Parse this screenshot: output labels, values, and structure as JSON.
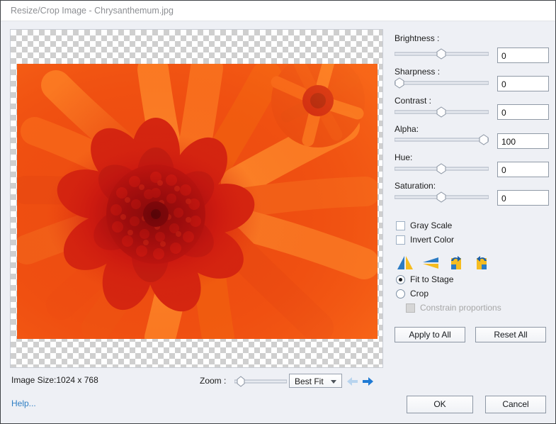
{
  "window": {
    "title": "Resize/Crop Image - Chrysanthemum.jpg"
  },
  "canvas": {
    "image_name": "Chrysanthemum.jpg",
    "image_alt": "Close-up photograph of an orange chrysanthemum flower with a deep red center",
    "transparency_checkerboard": true
  },
  "adjustments": [
    {
      "label": "Brightness :",
      "value": "0",
      "slider_pct": 50
    },
    {
      "label": "Sharpness :",
      "value": "0",
      "slider_pct": 0
    },
    {
      "label": "Contrast :",
      "value": "0",
      "slider_pct": 50
    },
    {
      "label": "Alpha:",
      "value": "100",
      "slider_pct": 100
    },
    {
      "label": "Hue:",
      "value": "0",
      "slider_pct": 50
    },
    {
      "label": "Saturation:",
      "value": "0",
      "slider_pct": 50
    }
  ],
  "checkboxes": [
    {
      "label": "Gray Scale",
      "checked": false,
      "enabled": true
    },
    {
      "label": "Invert Color",
      "checked": false,
      "enabled": true
    }
  ],
  "transform_icons": [
    {
      "name": "flip-vertical-icon",
      "tooltip": "Flip Vertical"
    },
    {
      "name": "flip-horizontal-icon",
      "tooltip": "Flip Horizontal"
    },
    {
      "name": "rotate-left-icon",
      "tooltip": "Rotate Left"
    },
    {
      "name": "rotate-right-icon",
      "tooltip": "Rotate Right"
    }
  ],
  "mode_radios": [
    {
      "label": "Fit to Stage",
      "selected": true
    },
    {
      "label": "Crop",
      "selected": false
    }
  ],
  "constrain": {
    "label": "Constrain proportions",
    "checked": false,
    "enabled": false
  },
  "panel_buttons": {
    "apply_to_all": "Apply to All",
    "reset_all": "Reset All"
  },
  "status": {
    "image_size": "Image Size:1024 x 768",
    "zoom_label": "Zoom :",
    "zoom_slider_pct": 12,
    "zoom_value": "Best Fit",
    "help": "Help..."
  },
  "dialog_buttons": {
    "ok": "OK",
    "cancel": "Cancel"
  },
  "colors": {
    "window_bg": "#eef0f5",
    "titlebar_bg": "#ffffff",
    "title_text": "#8d8f93",
    "link": "#2f7fc4",
    "icon_blue": "#2b7bc4",
    "icon_yellow": "#f5bc20",
    "arrow_active": "#1f7ad4",
    "arrow_disabled": "#b8d4ee",
    "disabled_text": "#a7a7a7"
  }
}
